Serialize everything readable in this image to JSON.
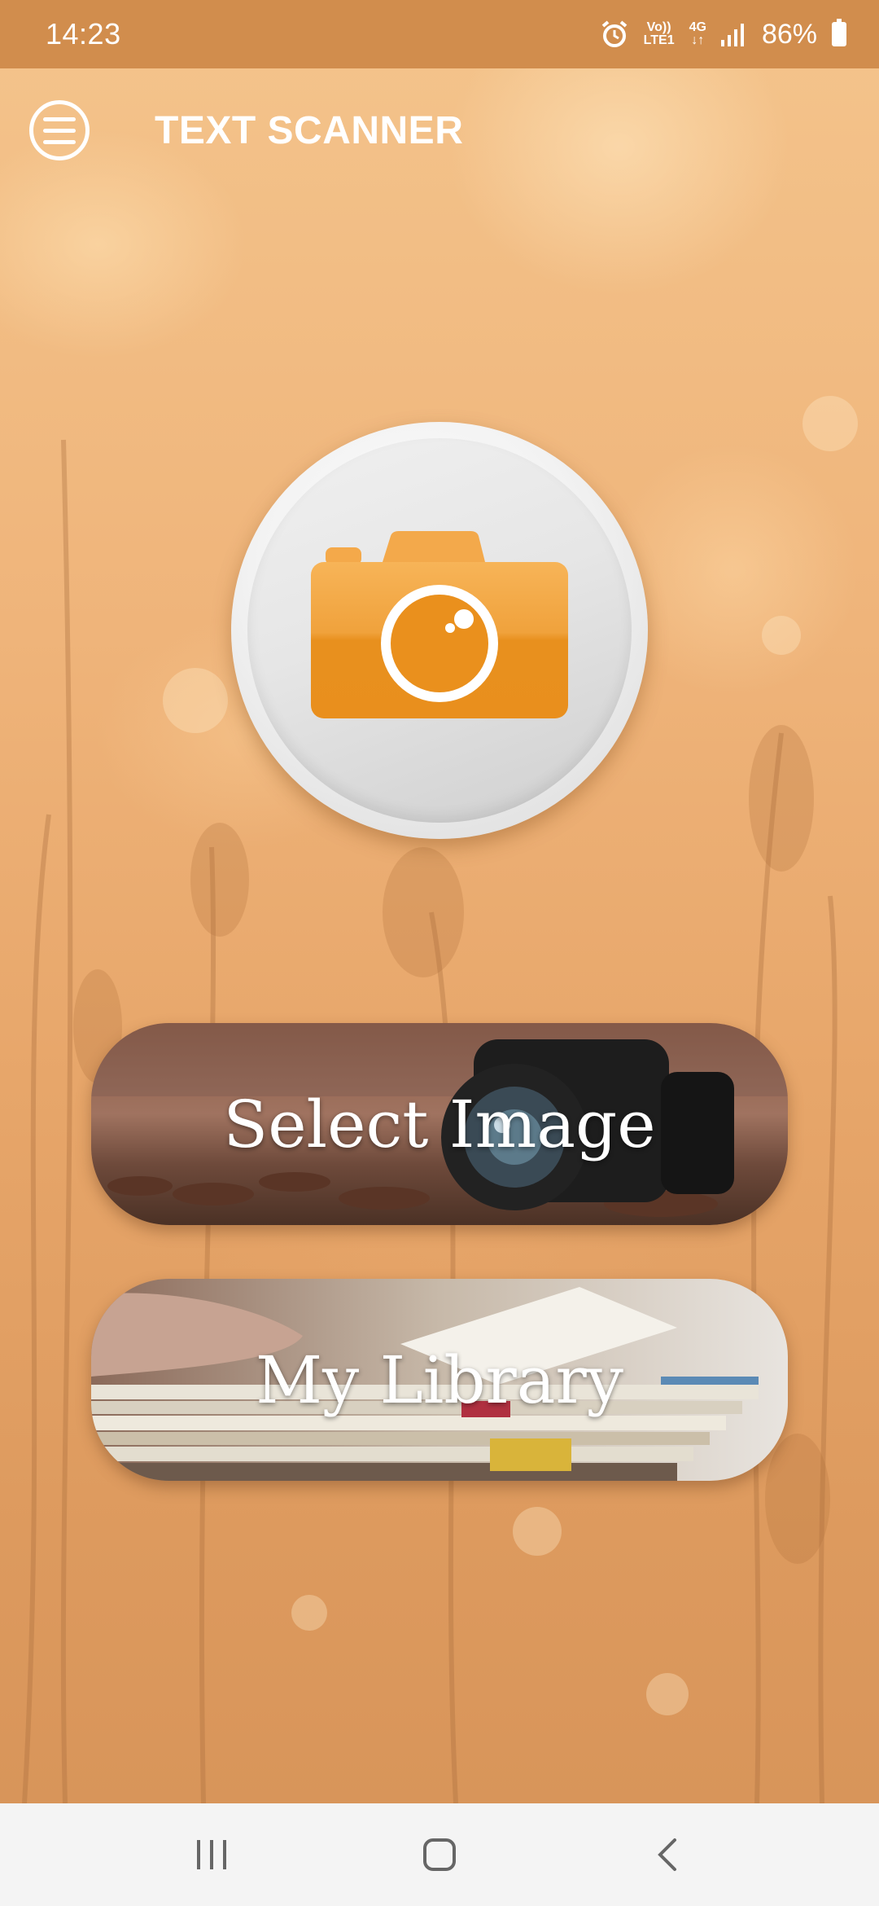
{
  "status_bar": {
    "time": "14:23",
    "network_volte": "Vo))",
    "network_lte": "LTE1",
    "network_type": "4G",
    "battery": "86%"
  },
  "app_bar": {
    "title": "TEXT SCANNER",
    "menu_icon": "hamburger-menu-icon"
  },
  "main": {
    "camera_button_icon": "camera-icon",
    "select_image_label": "Select Image",
    "my_library_label": "My Library"
  },
  "nav_bar": {
    "recents_icon": "recents-icon",
    "home_icon": "home-icon",
    "back_icon": "back-icon"
  },
  "colors": {
    "status_bar": "#d18d4d",
    "accent_orange": "#ef9a2c",
    "nav_bar": "#f4f4f4"
  }
}
